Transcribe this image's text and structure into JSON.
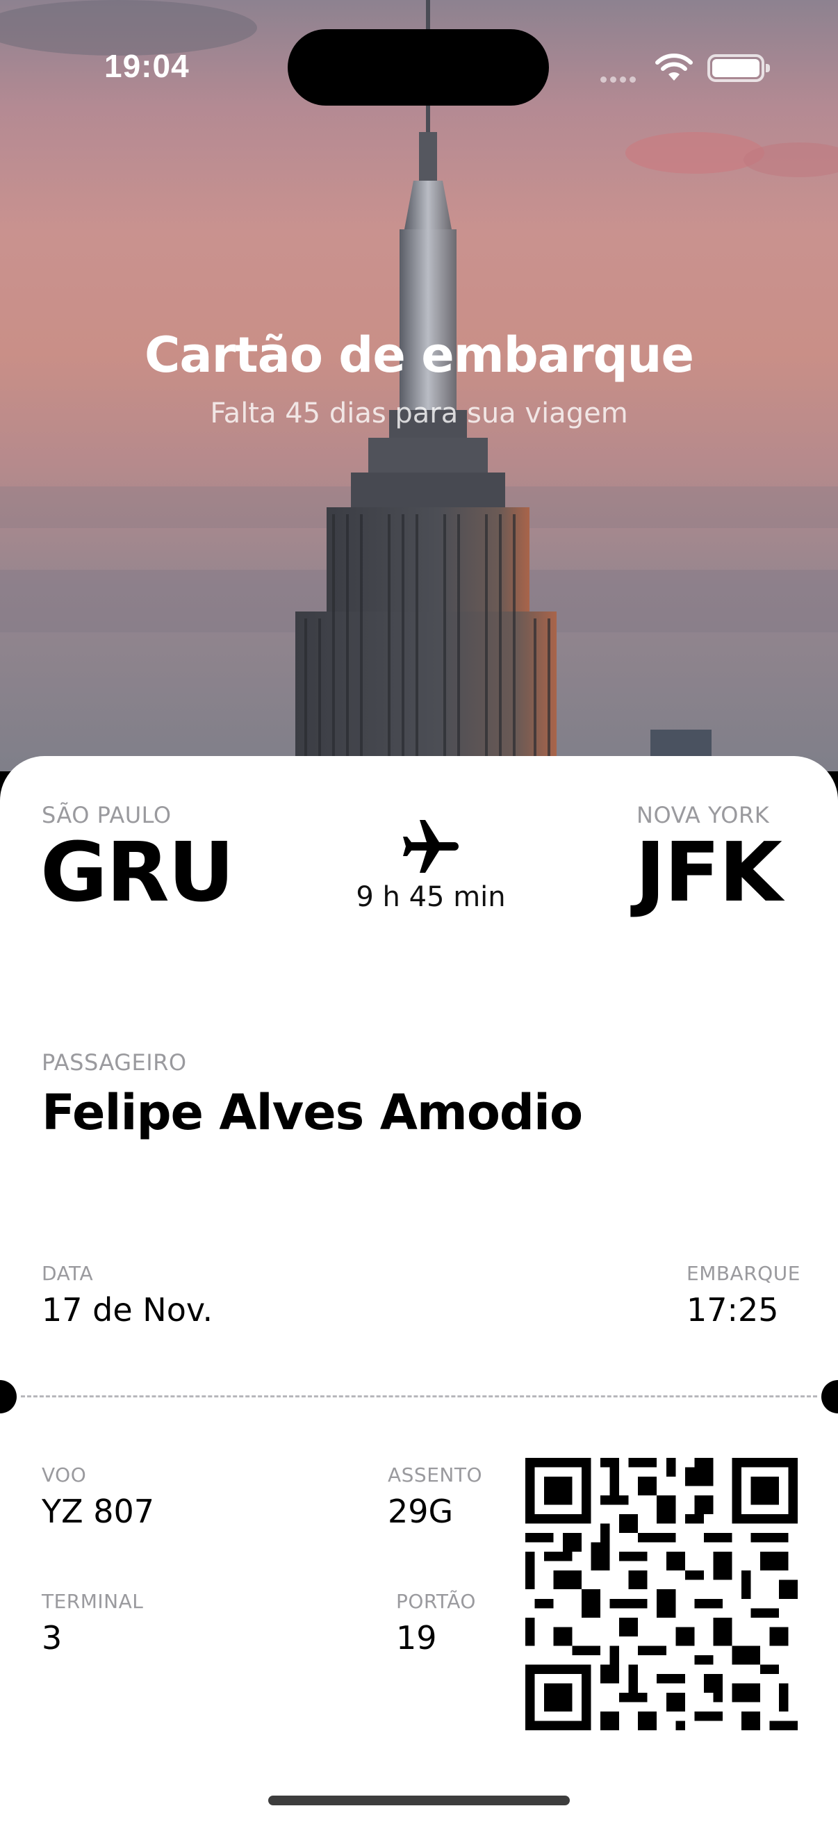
{
  "status_bar": {
    "time": "19:04",
    "icons": [
      "signal-dots-icon",
      "wifi-icon",
      "battery-icon"
    ]
  },
  "hero": {
    "title": "Cartão de embarque",
    "subtitle": "Falta 45 dias para sua viagem",
    "image": "empire-state-building-sunset"
  },
  "flight": {
    "origin": {
      "city": "SÃO PAULO",
      "code": "GRU"
    },
    "destination": {
      "city": "NOVA YORK",
      "code": "JFK"
    },
    "duration": "9 h 45 min",
    "icon": "airplane-icon"
  },
  "passenger": {
    "label": "PASSAGEIRO",
    "name": "Felipe Alves Amodio"
  },
  "schedule": {
    "date_label": "DATA",
    "date": "17 de Nov.",
    "boarding_label": "EMBARQUE",
    "boarding_time": "17:25"
  },
  "details": {
    "flight_label": "VOO",
    "flight": "YZ 807",
    "seat_label": "ASSENTO",
    "seat": "29G",
    "terminal_label": "TERMINAL",
    "terminal": "3",
    "gate_label": "PORTÃO",
    "gate": "19"
  },
  "qr_code": {
    "icon": "qr-code"
  },
  "colors": {
    "card_background": "#ffffff",
    "label_gray": "#9a9a9e",
    "text": "#000000"
  }
}
